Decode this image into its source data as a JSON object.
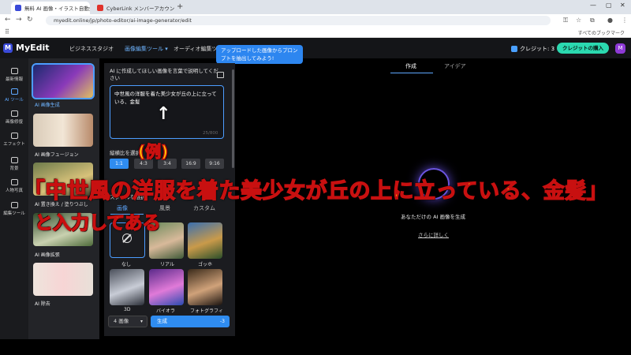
{
  "browser": {
    "tabs": [
      {
        "title": "無料 AI 画像・イラスト自動生成で",
        "active": true
      },
      {
        "title": "CyberLink メンバーアカウント認証メ",
        "active": false
      }
    ],
    "url": "myedit.online/jp/photo-editor/ai-image-generator/edit",
    "bookmarks_all": "すべてのブックマーク"
  },
  "app": {
    "logo": "MyEdit",
    "logo_mark": "M",
    "menus": [
      "ビジネススタジオ",
      "画像編集ツール",
      "オーディオ編集ツール"
    ],
    "menu_chevron": "▾",
    "tooltip": "アップロードした画像からプロンプトを抽出してみよう!",
    "credit_label": "クレジット: 3",
    "buy_button": "クレジットの購入",
    "avatar": "M",
    "colors": {
      "accent": "#2f8cf0",
      "buy": "#2bd9b0",
      "bg": "#141518"
    }
  },
  "rail": [
    {
      "label": "最新情報",
      "active": false
    },
    {
      "label": "AI ツール",
      "active": true
    },
    {
      "label": "画像修復",
      "active": false
    },
    {
      "label": "エフェクト",
      "active": false
    },
    {
      "label": "背景",
      "active": false
    },
    {
      "label": "人物写真",
      "active": false
    },
    {
      "label": "編集ツール",
      "active": false
    }
  ],
  "tools": [
    {
      "label": "AI 画像生成",
      "active": true
    },
    {
      "label": "AI 画像フュージョン",
      "active": false
    },
    {
      "label": "AI 置き換え / 塗りつぶし",
      "active": false
    },
    {
      "label": "AI 画像拡張",
      "active": false
    },
    {
      "label": "AI 除去",
      "active": false
    }
  ],
  "panel": {
    "title": "AI に作成してほしい画像を言葉で説明してください",
    "prompt_value": "中世風の洋服を着た美少女が丘の上に立っている、金髪",
    "prompt_count": "25/800",
    "ratio_label": "縦横比を選択",
    "ratios": [
      "1:1",
      "4:3",
      "3:4",
      "16:9",
      "9:16"
    ],
    "style_label": "スタイルを選択",
    "style_tabs": [
      "画像",
      "風景",
      "カスタム"
    ],
    "styles": [
      "なし",
      "リアル",
      "ゴッホ",
      "3D",
      "バイオラ",
      "フォトグラフィ"
    ],
    "count_select": "4 画像",
    "generate_label": "生成",
    "generate_cost": "-3"
  },
  "main": {
    "tabs": [
      "作成",
      "アイデア"
    ],
    "caption": "あなただけの AI 画像を生成",
    "link": "さらに詳しく"
  },
  "overlay": {
    "arrow": "↑",
    "example": "(例)",
    "quote": "「中世風の洋服を着た美少女が丘の上に立っている、金髪」",
    "sub": "と入力してある"
  }
}
